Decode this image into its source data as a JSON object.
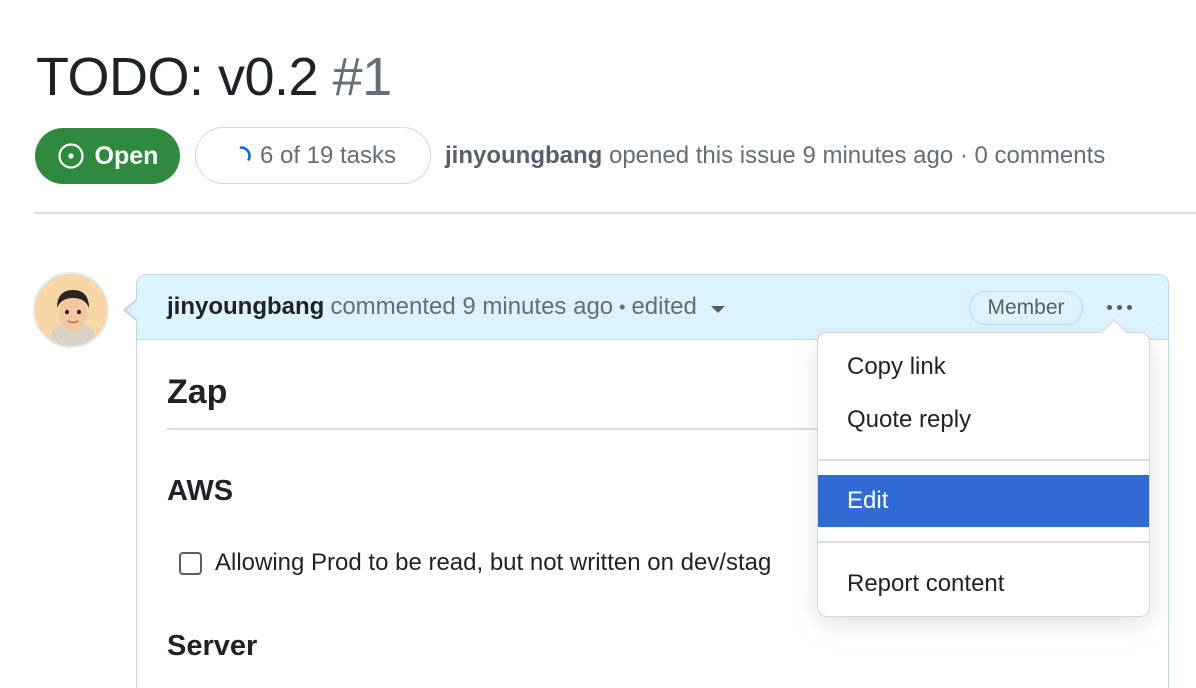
{
  "issue": {
    "title": "TODO: v0.2",
    "number": "#1",
    "state_label": "Open",
    "tasks_label": "6 of 19 tasks",
    "tasks_done": 6,
    "tasks_total": 19,
    "author": "jinyoungbang",
    "meta_text": "opened this issue 9 minutes ago · 0 comments"
  },
  "comment": {
    "author": "jinyoungbang",
    "meta_text": "commented 9 minutes ago",
    "separator": "•",
    "edited_label": "edited",
    "role_badge": "Member",
    "body": {
      "h1": "Zap",
      "section_aws": "AWS",
      "task_1": "Allowing Prod to be read, but not written on dev/stag",
      "section_server": "Server"
    }
  },
  "menu": {
    "copy_link": "Copy link",
    "quote_reply": "Quote reply",
    "edit": "Edit",
    "report": "Report content"
  },
  "colors": {
    "open_green": "#2f8a3e",
    "header_blue": "#ddf4ff",
    "menu_active": "#2f6bd3",
    "progress_blue": "#0969da"
  },
  "icons": {
    "state": "issue-open-icon",
    "progress": "progress-ring-icon",
    "more": "kebab-horizontal-icon"
  }
}
